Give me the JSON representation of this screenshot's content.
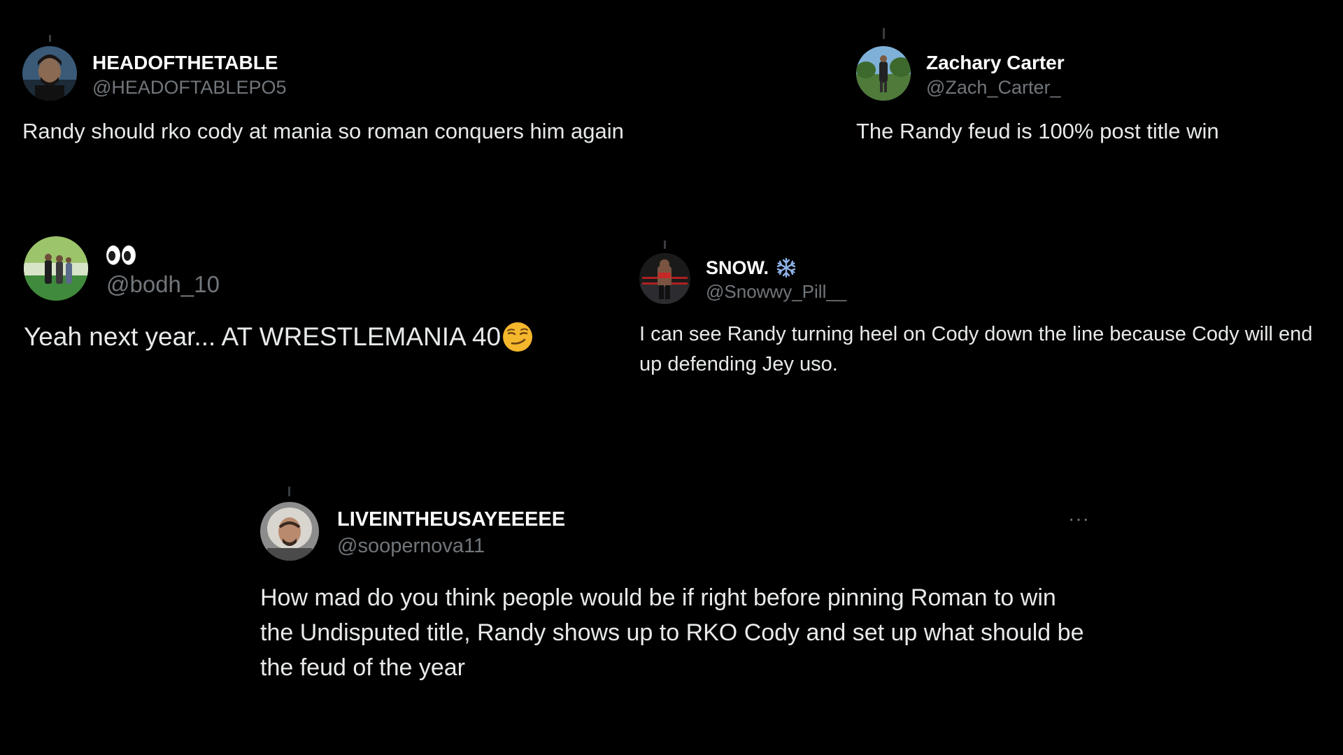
{
  "tweets": [
    {
      "display_name": "HEADOFTHETABLE",
      "handle": "@HEADOFTABLEPO5",
      "text": "Randy should rko cody at mania so roman conquers him again"
    },
    {
      "display_name": "Zachary Carter",
      "handle": "@Zach_Carter_",
      "text": "The Randy feud is 100% post title win"
    },
    {
      "display_name_icon": "eyes-emoji",
      "handle": "@bodh_10",
      "text": "Yeah next year... AT WRESTLEMANIA 40",
      "text_emoji": "smirking-face-emoji"
    },
    {
      "display_name": "SNOW.",
      "display_name_icon": "snowflake-emoji",
      "handle": "@Snowwy_Pill__",
      "text": "I can see Randy turning heel on Cody down the line because Cody will end up defending Jey uso."
    },
    {
      "display_name": "LIVEINTHEUSAYEEEEE",
      "handle": "@soopernova11",
      "more_label": "···",
      "text": "How mad do you think people would be if right before pinning Roman to win the Undisputed title, Randy shows up to RKO Cody and set up what should be the feud of the year"
    }
  ],
  "colors": {
    "background": "#000000",
    "display_name": "#ffffff",
    "handle": "#71767b",
    "body_text": "#e7e9ea",
    "snowflake": "#8fb3e8",
    "emoji_yellow": "#f5b72c"
  }
}
